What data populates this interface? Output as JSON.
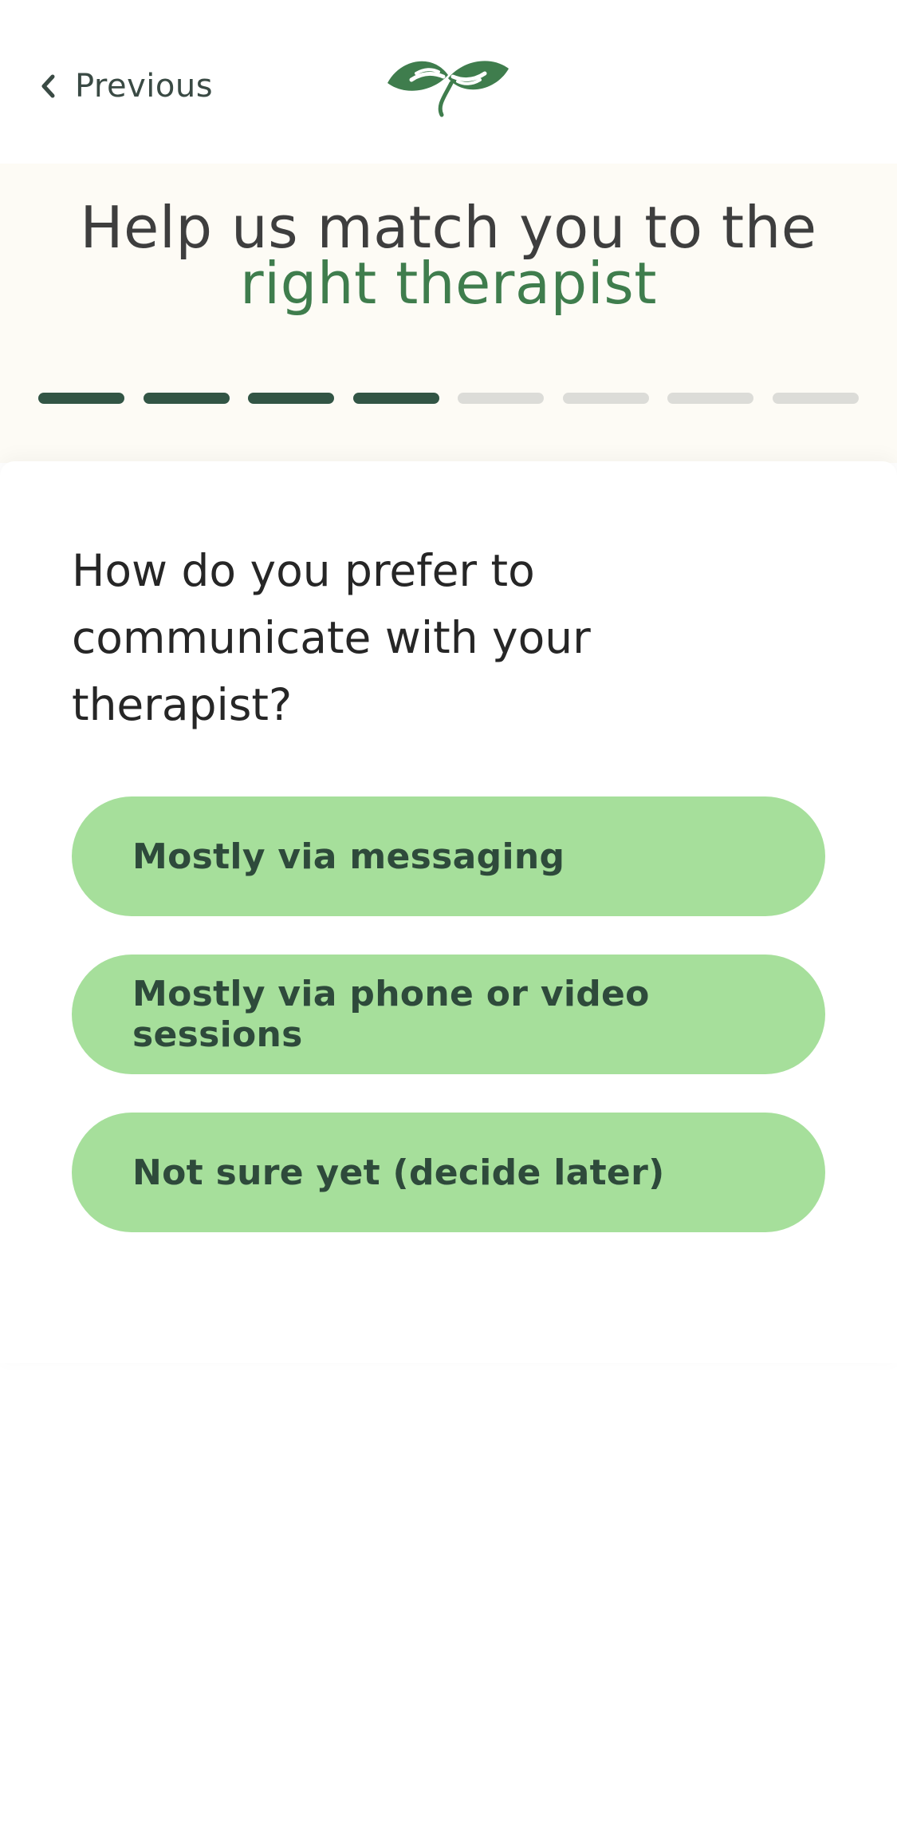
{
  "header": {
    "back_label": "Previous",
    "back_icon": "chevron-left-icon",
    "logo_icon": "leaf-hands-logo-icon"
  },
  "hero": {
    "title_line1": "Help us match you to the",
    "title_line2": "right therapist",
    "progress": {
      "completed_steps": 4,
      "total_steps": 8
    }
  },
  "question": {
    "text": "How do you prefer to communicate with your therapist?",
    "options": [
      {
        "label": "Mostly via messaging"
      },
      {
        "label": "Mostly via phone or video sessions"
      },
      {
        "label": "Not sure yet (decide later)"
      }
    ]
  },
  "colors": {
    "accent_green": "#3f7d4d",
    "progress_done": "#325545",
    "progress_todo": "#dcdcd8",
    "option_bg": "#a6df9b",
    "option_text": "#2e4a3b",
    "hero_bg": "#fdfbf5"
  }
}
